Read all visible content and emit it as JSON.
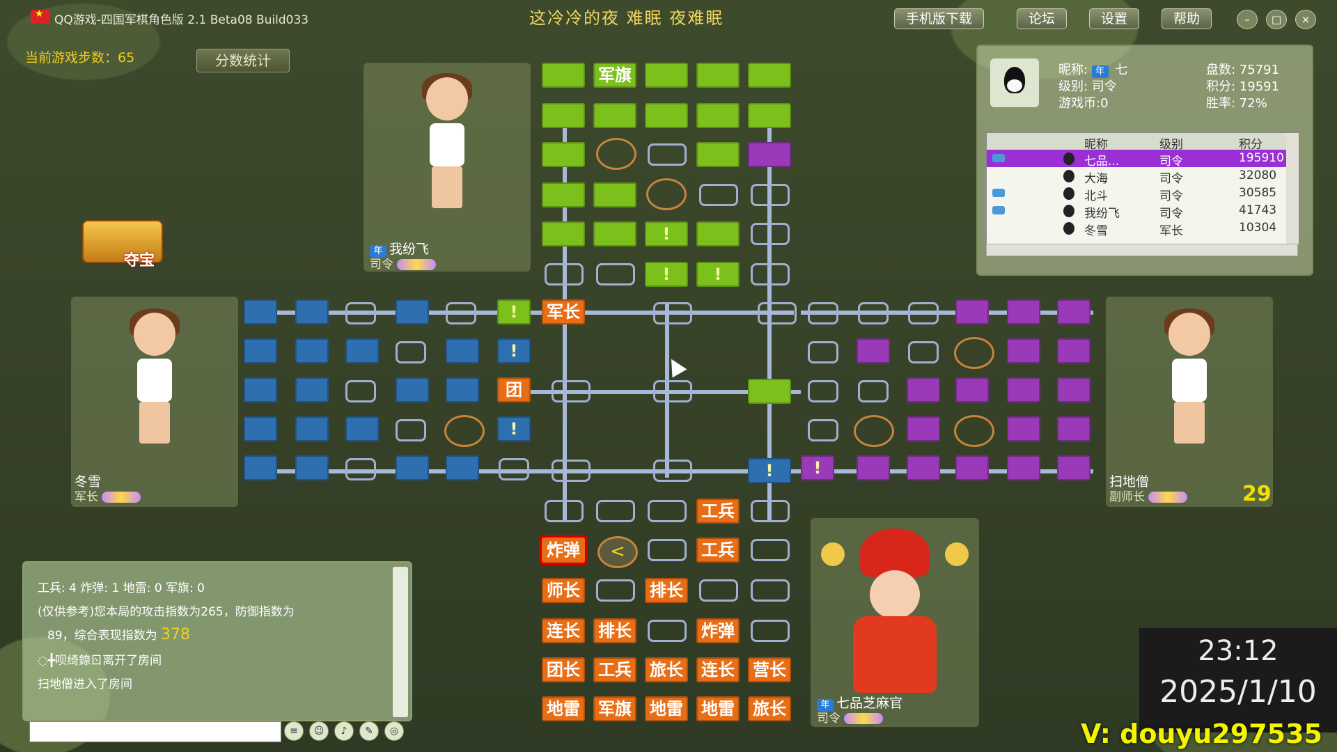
{
  "window": {
    "title": "QQ游戏-四国军棋角色版 2.1 Beta08 Build033",
    "song": "这冷冷的夜 难眠 夜难眠",
    "buttons": [
      "手机版下载",
      "论坛",
      "设置",
      "帮助"
    ],
    "win_controls": [
      "minimize-icon",
      "maximize-icon",
      "close-icon"
    ]
  },
  "game": {
    "steps_label": "当前游戏步数：65",
    "score_button": "分数统计",
    "treasure_label": "夺宝",
    "turn_counter": "29"
  },
  "players": {
    "top": {
      "name": "我纷飞",
      "rank": "司令",
      "badge": "年"
    },
    "left": {
      "name": "冬雪",
      "rank": "军长"
    },
    "right": {
      "name": "扫地僧",
      "rank": "副师长"
    },
    "bottom": {
      "name": "七品芝麻官",
      "rank": "司令",
      "badge": "年"
    }
  },
  "info_panel": {
    "nickname_label": "昵称:",
    "nickname": "七",
    "badge": "年",
    "level_label": "级别: 司令",
    "coins_label": "游戏币:0",
    "games_label": "盘数: 75791",
    "points_label": "积分: 19591",
    "winrate_label": "胜率: 72%",
    "columns": [
      "昵称",
      "级别",
      "积分"
    ],
    "rows": [
      {
        "name": "七品...",
        "rank": "司令",
        "score": "195910",
        "selected": true,
        "gem": true
      },
      {
        "name": "大海",
        "rank": "司令",
        "score": "32080",
        "selected": false,
        "gem": false
      },
      {
        "name": "北斗",
        "rank": "司令",
        "score": "30585",
        "selected": false,
        "gem": true
      },
      {
        "name": "我纷飞",
        "rank": "司令",
        "score": "41743",
        "selected": false,
        "gem": true
      },
      {
        "name": "冬雪",
        "rank": "军长",
        "score": "10304",
        "selected": false,
        "gem": false
      }
    ]
  },
  "board": {
    "top_flag_label": "军旗",
    "left_piece_label": "军长",
    "left_row_label": "团",
    "hidden_mark": "!",
    "side_label": "司令",
    "bottom_pieces": {
      "r1": [
        "工兵"
      ],
      "r2": [
        "炸弹",
        "工兵"
      ],
      "r3": [
        "师长",
        "排长"
      ],
      "r4": [
        "连长",
        "排长",
        "炸弹"
      ],
      "r5": [
        "团长",
        "工兵",
        "旅长",
        "连长",
        "营长"
      ],
      "r6": [
        "地雷",
        "军旗",
        "地雷",
        "地雷",
        "旅长"
      ]
    },
    "arrow_glyph": "<"
  },
  "chat": {
    "lines": [
      "工兵: 4 炸弹: 1 地雷: 0 军旗: 0",
      "(仅供参考)您本局的攻击指数为265，防御指数为",
      "89，综合表现指数为",
      "378",
      "◌╋呗绮錼ㄖ离开了房间",
      "扫地僧进入了房间"
    ],
    "input_value": ""
  },
  "clock": {
    "time": "23:12",
    "date": "2025/1/10"
  },
  "watermark": "V: douyu297535",
  "colors": {
    "green": "#7cc01c",
    "purple": "#9a3ab8",
    "blue": "#2e6fb0",
    "orange": "#e86d14"
  }
}
